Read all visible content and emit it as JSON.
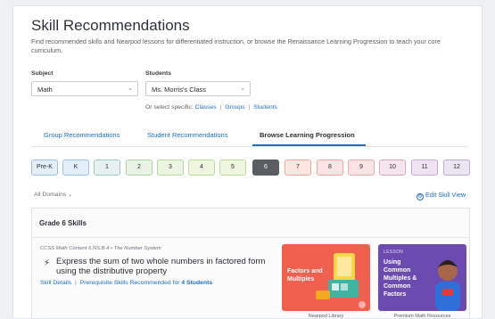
{
  "page": {
    "title": "Skill Recommendations",
    "intro": "Find recommended skills and Nearpod lessons for differentiated instruction, or browse the Renaissance Learning Progression to teach your core curriculum."
  },
  "filters": {
    "subject_label": "Subject",
    "subject_value": "Math",
    "students_label": "Students",
    "students_value": "Ms. Morris's Class",
    "or_select_prefix": "Or select specific:",
    "classes_link": "Classes",
    "groups_link": "Groups",
    "students_link": "Students",
    "separator": "|"
  },
  "tabs": [
    {
      "label": "Group Recommendations",
      "active": false
    },
    {
      "label": "Student Recommendations",
      "active": false
    },
    {
      "label": "Browse Learning Progression",
      "active": true
    }
  ],
  "grades": [
    {
      "label": "Pre-K",
      "bg": "#e3eef8",
      "border": "#9fc2e6"
    },
    {
      "label": "K",
      "bg": "#e3eef8",
      "border": "#9fc2e6"
    },
    {
      "label": "1",
      "bg": "#e6f1ef",
      "border": "#9fcdc4"
    },
    {
      "label": "2",
      "bg": "#e8f3e6",
      "border": "#a9d5a0"
    },
    {
      "label": "3",
      "bg": "#ecf5e2",
      "border": "#b5d99a"
    },
    {
      "label": "4",
      "bg": "#eef6e0",
      "border": "#bcdc98"
    },
    {
      "label": "5",
      "bg": "#eef6e0",
      "border": "#bcdc98"
    },
    {
      "label": "6",
      "bg": "#5a5e62",
      "border": "#5a5e62",
      "selected": true
    },
    {
      "label": "7",
      "bg": "#fbe6e1",
      "border": "#efaa9b"
    },
    {
      "label": "8",
      "bg": "#fbe3e4",
      "border": "#efa6ab"
    },
    {
      "label": "9",
      "bg": "#fbe3e6",
      "border": "#eda5b0"
    },
    {
      "label": "10",
      "bg": "#f7e3ec",
      "border": "#e0a9c3"
    },
    {
      "label": "11",
      "bg": "#f1e4f2",
      "border": "#cfa7d6"
    },
    {
      "label": "12",
      "bg": "#ebe5f4",
      "border": "#bda9dc"
    }
  ],
  "domain_filter": "All Domains",
  "edit_skill_view": "Edit Skill View",
  "skills": {
    "heading": "Grade 6 Skills",
    "standard": "CCSS Math Content 6.NS.B.4 • The Number System",
    "title": "Express the sum of two whole numbers in factored form using the distributive property",
    "details_link": "Skill Details",
    "prereq_link_prefix": "Prerequisite Skills Recommended for",
    "prereq_count": "4 Students",
    "separator": "|"
  },
  "cards": [
    {
      "tag": "",
      "title": "Factors and Multiples",
      "caption": "Nearpod Library"
    },
    {
      "tag": "LESSON",
      "title": "Using Common Multiples & Common Factors",
      "caption": "Premium Math Resources"
    }
  ],
  "colors": {
    "accent": "#1f6fbf",
    "card_orange": "#f0604f",
    "card_purple": "#6b4bb0"
  }
}
